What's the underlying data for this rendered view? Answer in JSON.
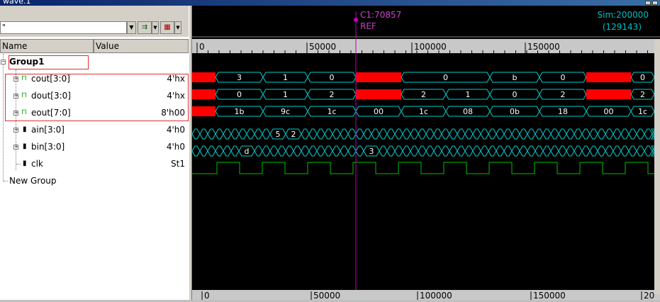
{
  "window": {
    "title": "wave.1"
  },
  "cursor": {
    "label": "C1:70857",
    "ref": "REF"
  },
  "sim": {
    "label": "Sim:200000",
    "count": "(129143)"
  },
  "search": {
    "value": "\""
  },
  "columns": {
    "name": "Name",
    "value": "Value"
  },
  "signals": [
    {
      "name": "Group1",
      "value": ""
    },
    {
      "name": "cout[3:0]",
      "value": "4'hx"
    },
    {
      "name": "dout[3:0]",
      "value": "4'hx"
    },
    {
      "name": "eout[7:0]",
      "value": "8'h00"
    },
    {
      "name": "ain[3:0]",
      "value": "4'h0"
    },
    {
      "name": "bin[3:0]",
      "value": "4'h0"
    },
    {
      "name": "clk",
      "value": "St1"
    },
    {
      "name": "New Group",
      "value": ""
    }
  ],
  "timeline": {
    "ticks": [
      "0",
      "50000",
      "100000",
      "150000"
    ],
    "bottom_ticks": [
      "0",
      "50000",
      "100000",
      "150000",
      "20"
    ]
  },
  "waves": {
    "cout": [
      "3",
      "1",
      "0",
      "0",
      "b",
      "0",
      "0"
    ],
    "dout": [
      "0",
      "1",
      "2",
      "2",
      "1",
      "0",
      "2",
      "2"
    ],
    "eout": [
      "1b",
      "9c",
      "1c",
      "00",
      "1c",
      "08",
      "0b",
      "18",
      "00",
      "1c"
    ],
    "ain": [
      "5",
      "2"
    ],
    "bin": [
      "d",
      "3"
    ]
  },
  "colors": {
    "wave": "#00d0d0",
    "clk": "#00c000",
    "x": "#ff0000",
    "cursor": "#c000c0"
  }
}
